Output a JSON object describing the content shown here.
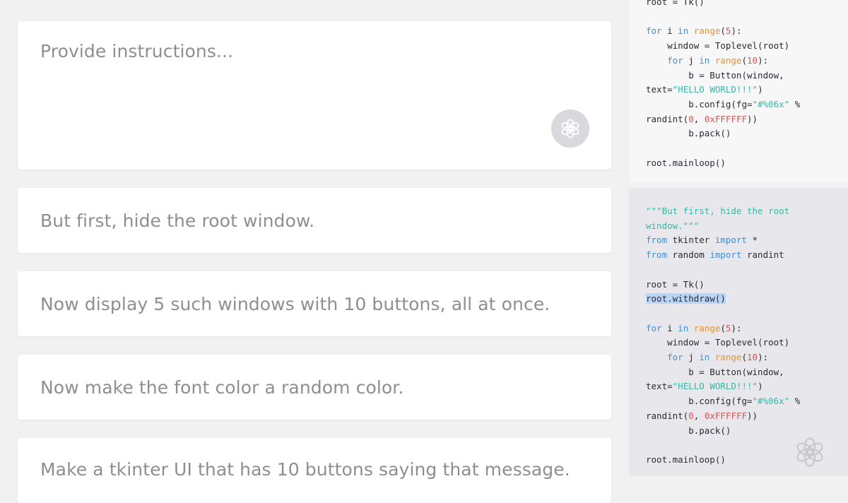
{
  "prompt_box": {
    "placeholder": "Provide instructions..."
  },
  "instructions": [
    "But first, hide the root window.",
    "Now display 5 such windows with 10 buttons, all at once.",
    "Now make the font color a random color.",
    "Make a tkinter UI that has 10 buttons saying that message."
  ],
  "code_top": {
    "line_root": "root = Tk()",
    "l_for_i_a": "for ",
    "l_for_i_b": "i ",
    "l_for_i_in": "in ",
    "l_for_i_range": "range",
    "l_for_i_c": "(",
    "l_for_i_num": "5",
    "l_for_i_d": "):",
    "l_window": "    window = Toplevel(root)",
    "l_for_j_a": "    ",
    "l_for_j_for": "for ",
    "l_for_j_b": "j ",
    "l_for_j_in": "in ",
    "l_for_j_range": "range",
    "l_for_j_c": "(",
    "l_for_j_num": "10",
    "l_for_j_d": "):",
    "l_button": "        b = Button(window,",
    "l_text_a": "text=",
    "l_text_str": "\"HELLO WORLD!!!\"",
    "l_text_b": ")",
    "l_config_a": "        b.config(fg=",
    "l_config_str": "\"#%06x\"",
    "l_config_b": " %",
    "l_rand_a": "randint(",
    "l_rand_n1": "0",
    "l_rand_b": ", ",
    "l_rand_n2": "0xFFFFFF",
    "l_rand_c": "))",
    "l_pack": "        b.pack()",
    "l_mainloop": "root.mainloop()"
  },
  "code_bottom": {
    "docstring_1": "\"\"\"But first, hide the root",
    "docstring_2": "window.\"\"\"",
    "from1_kw": "from",
    "from1_mod": " tkinter ",
    "from1_import": "import",
    "from1_rest": " *",
    "from2_kw": "from",
    "from2_mod": " random ",
    "from2_import": "import",
    "from2_rest": " randint",
    "line_root": "root = Tk()",
    "withdraw_1": "r",
    "withdraw_2": "oot.withdraw()",
    "l_for_i_a": "for ",
    "l_for_i_b": "i ",
    "l_for_i_in": "in ",
    "l_for_i_range": "range",
    "l_for_i_c": "(",
    "l_for_i_num": "5",
    "l_for_i_d": "):",
    "l_window": "    window = Toplevel(root)",
    "l_for_j_a": "    ",
    "l_for_j_for": "for ",
    "l_for_j_b": "j ",
    "l_for_j_in": "in ",
    "l_for_j_range": "range",
    "l_for_j_c": "(",
    "l_for_j_num": "10",
    "l_for_j_d": "):",
    "l_button": "        b = Button(window,",
    "l_text_a": "text=",
    "l_text_str": "\"HELLO WORLD!!!\"",
    "l_text_b": ")",
    "l_config_a": "        b.config(fg=",
    "l_config_str": "\"#%06x\"",
    "l_config_b": " %",
    "l_rand_a": "randint(",
    "l_rand_n1": "0",
    "l_rand_b": ", ",
    "l_rand_n2": "0xFFFFFF",
    "l_rand_c": "))",
    "l_pack": "        b.pack()",
    "l_mainloop": "root.mainloop()"
  },
  "icons": {
    "prompt_logo": "openai-logo-icon",
    "corner_logo": "openai-logo-icon"
  },
  "colors": {
    "keyword": "#3d8fd6",
    "builtin": "#e0923a",
    "number": "#d05a5a",
    "string": "#3ab5a6",
    "selection": "#b8d6f7"
  }
}
